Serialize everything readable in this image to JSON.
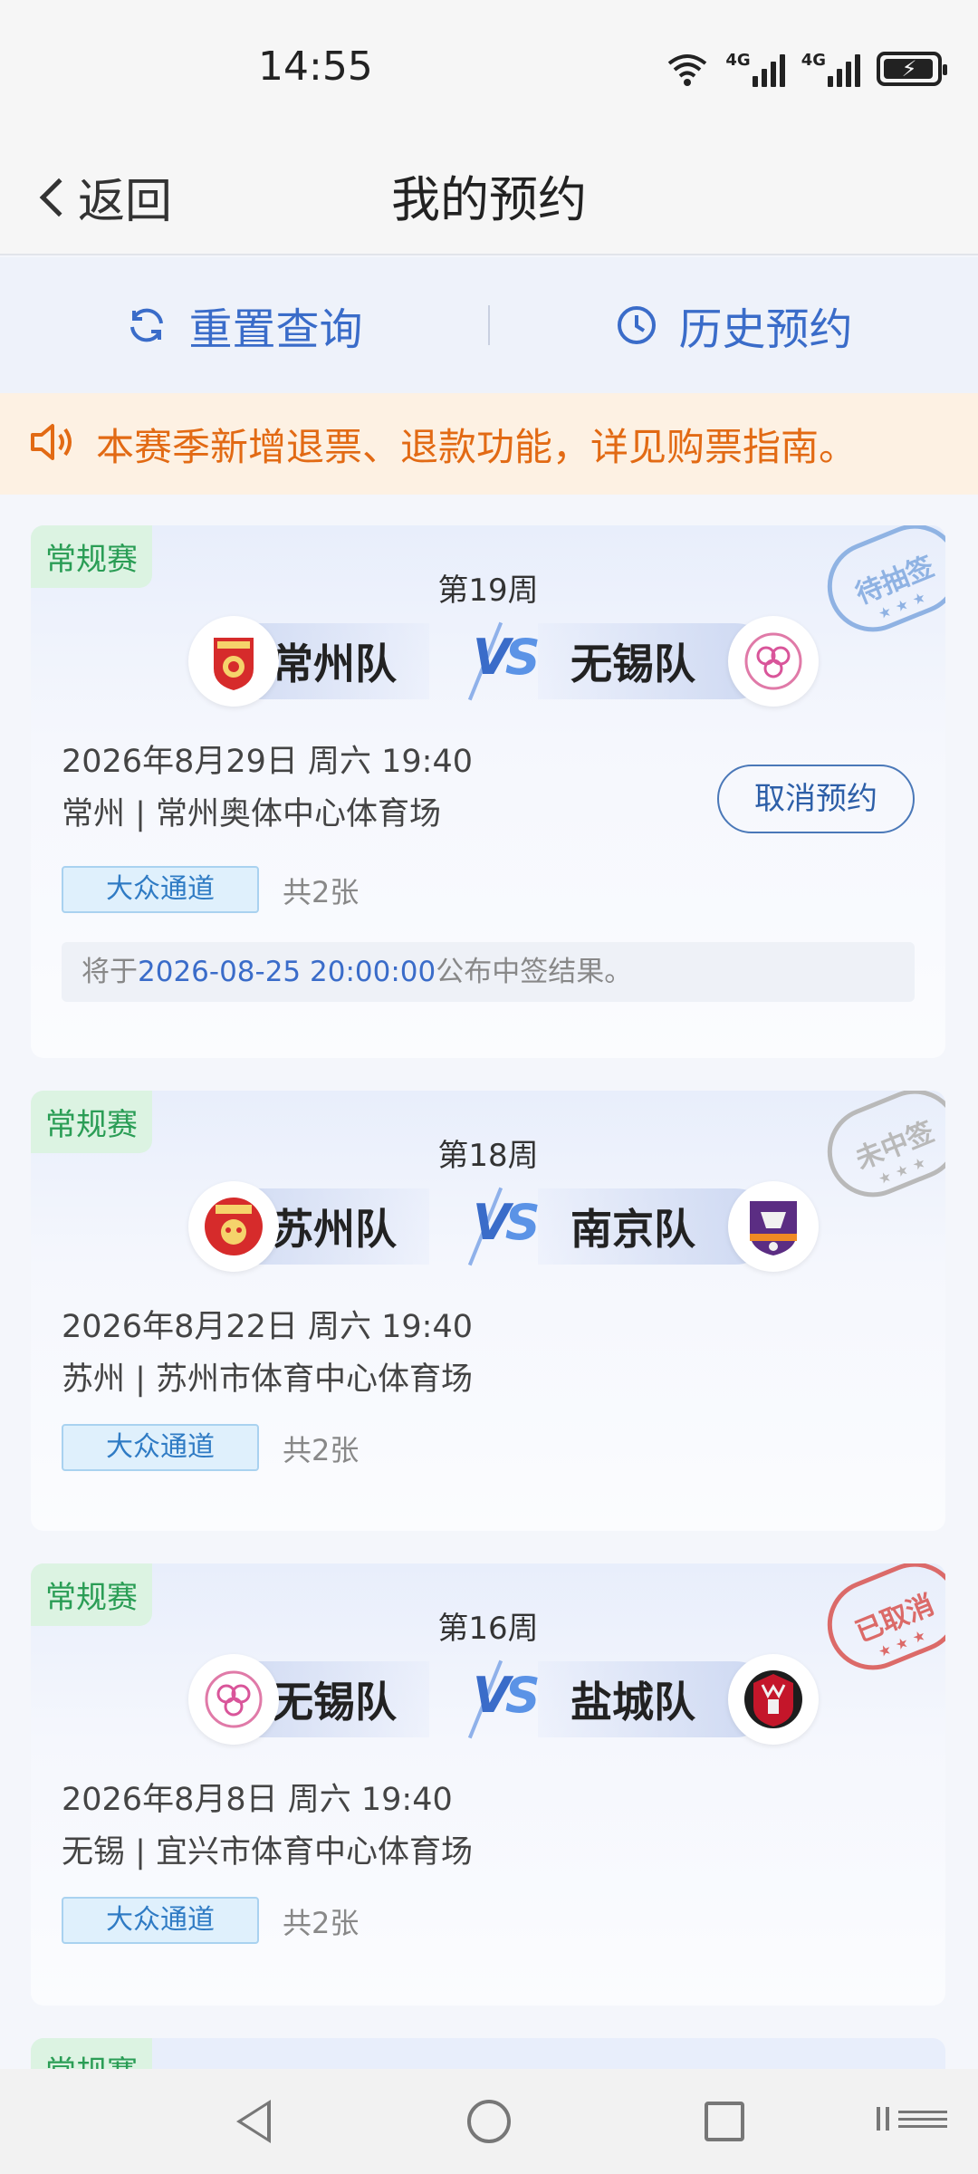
{
  "status_bar": {
    "time": "14:55",
    "signal1_label": "4G",
    "signal2_label": "4G",
    "battery_icon": "battery-charging-icon",
    "wifi_icon": "wifi-icon"
  },
  "header": {
    "back_label": "返回",
    "title": "我的预约"
  },
  "actions": {
    "reset_label": "重置查询",
    "history_label": "历史预约"
  },
  "notice": {
    "text": "本赛季新增退票、退款功能，详见购票指南。"
  },
  "reservations": [
    {
      "tag": "常规赛",
      "stamp": "待抽签",
      "round": "第19周",
      "home_team": "常州队",
      "away_team": "无锡队",
      "datetime": "2026年8月29日 周六 19:40",
      "venue": "常州 | 常州奥体中心体育场",
      "channel": "大众通道",
      "count": "共2张",
      "cancel_label": "取消预约",
      "note_prefix": "将于",
      "note_time": "2026-08-25 20:00:00",
      "note_suffix": "公布中签结果。"
    },
    {
      "tag": "常规赛",
      "stamp": "未中签",
      "round": "第18周",
      "home_team": "苏州队",
      "away_team": "南京队",
      "datetime": "2026年8月22日 周六 19:40",
      "venue": "苏州 | 苏州市体育中心体育场",
      "channel": "大众通道",
      "count": "共2张"
    },
    {
      "tag": "常规赛",
      "stamp": "已取消",
      "round": "第16周",
      "home_team": "无锡队",
      "away_team": "盐城队",
      "datetime": "2026年8月8日 周六 19:40",
      "venue": "无锡 | 宜兴市体育中心体育场",
      "channel": "大众通道",
      "count": "共2张"
    },
    {
      "tag": "常规赛"
    }
  ],
  "vs_label": "VS",
  "colors": {
    "accent": "#3a6cc9",
    "notice_text": "#e26a14",
    "tag_green": "#2a9d55"
  }
}
